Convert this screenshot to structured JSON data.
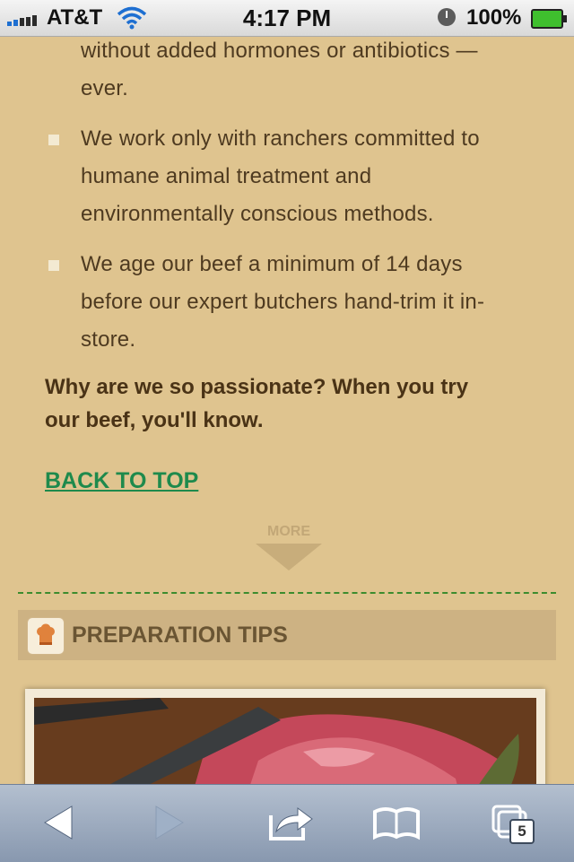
{
  "status_bar": {
    "carrier": "AT&T",
    "time": "4:17 PM",
    "battery": "100%"
  },
  "content": {
    "bullet_intro_lines": [
      "without added hormones or antibiotics —",
      "ever."
    ],
    "bullets": [
      {
        "lines": [
          "We work only with ranchers committed to",
          "humane animal treatment and",
          "environmentally conscious methods."
        ]
      },
      {
        "lines": [
          "We age our beef a minimum of 14 days",
          "before our expert butchers hand-trim it in-",
          "store."
        ]
      }
    ],
    "passion_lines": [
      "Why are we so passionate? When you try",
      "our beef, you'll know."
    ],
    "back_to_top": "BACK TO TOP",
    "more_label": "MORE"
  },
  "section": {
    "title": "PREPARATION TIPS",
    "icon": "chef-hat-icon"
  },
  "toolbar": {
    "tab_count": "5",
    "icons": [
      "back-arrow-icon",
      "forward-arrow-icon",
      "share-icon",
      "bookmarks-icon",
      "tabs-icon"
    ]
  },
  "colors": {
    "background": "#dfc48f",
    "text": "#4e3a20",
    "link": "#1e8a4c",
    "section_bar": "#cdb283",
    "divider": "#3c8c2e"
  }
}
